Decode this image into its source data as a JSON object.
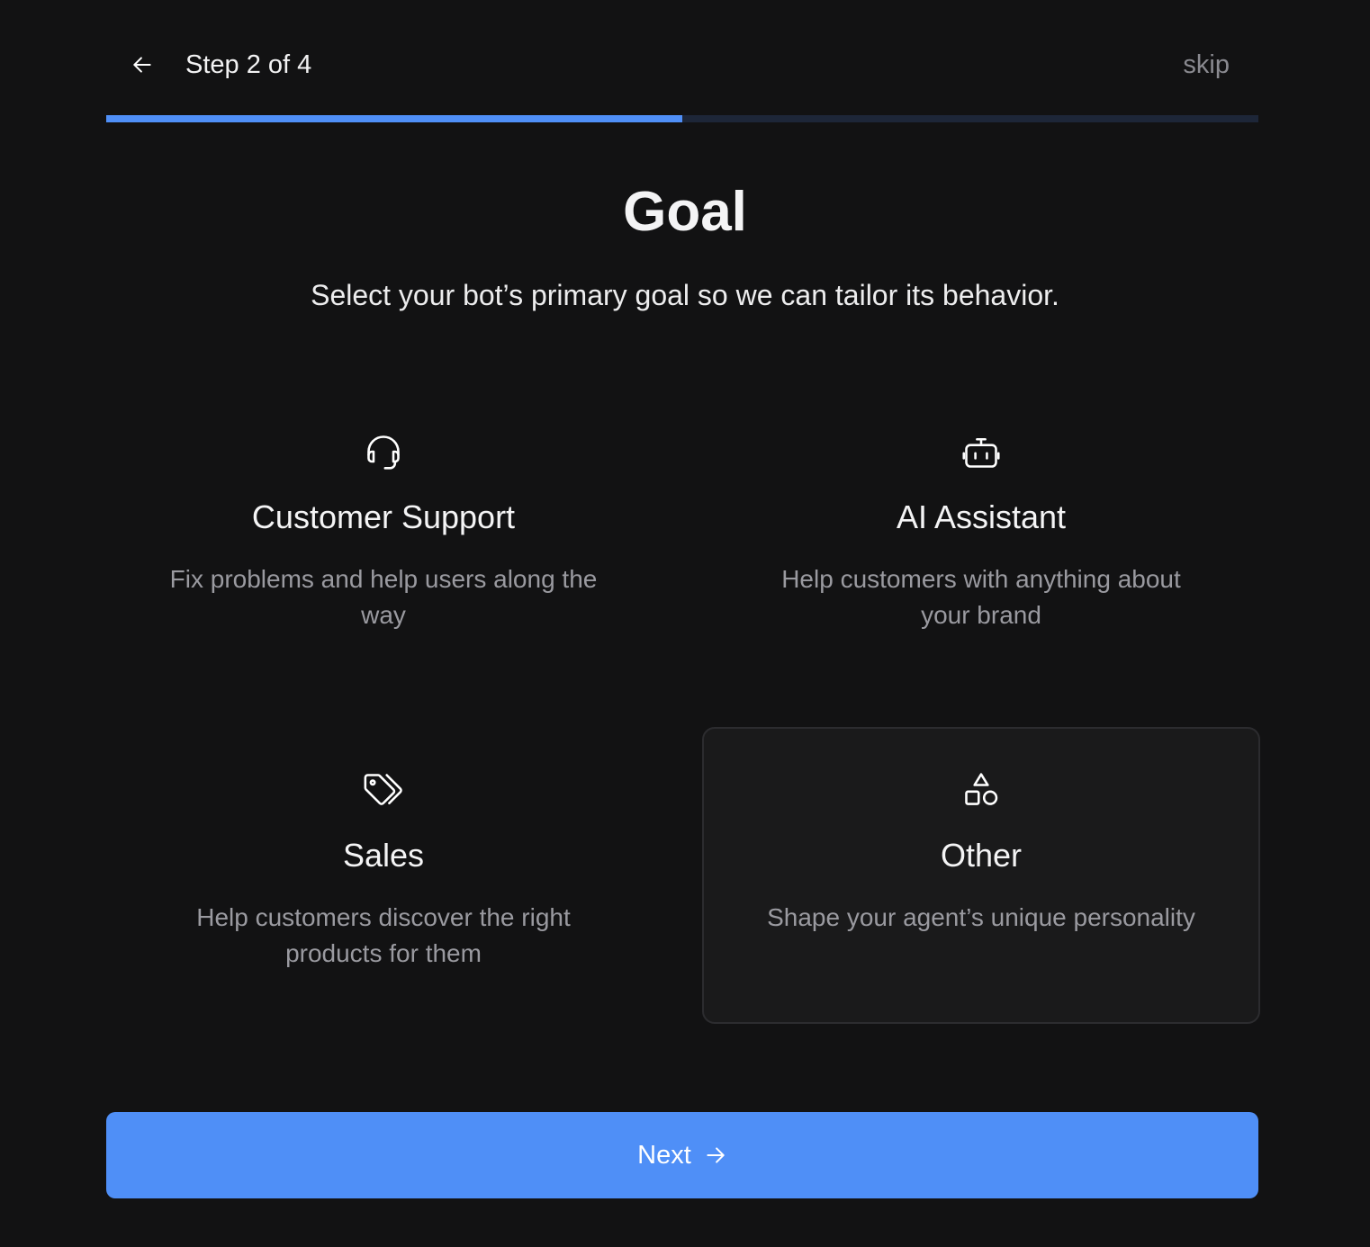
{
  "header": {
    "step_label": "Step 2 of 4",
    "skip_label": "skip",
    "back_icon": "arrow-left-icon"
  },
  "progress": {
    "current_step": 2,
    "total_steps": 4,
    "fraction": 0.5,
    "fill_color": "#4f8ff7",
    "track_color": "#1d2638"
  },
  "main": {
    "title": "Goal",
    "subtitle": "Select your bot’s primary goal so we can tailor its behavior."
  },
  "options": [
    {
      "id": "customer-support",
      "icon": "headset-icon",
      "title": "Customer Support",
      "description": "Fix problems and help users along the way",
      "selected": false
    },
    {
      "id": "ai-assistant",
      "icon": "robot-icon",
      "title": "AI Assistant",
      "description": "Help customers with anything about your brand",
      "selected": false
    },
    {
      "id": "sales",
      "icon": "tags-icon",
      "title": "Sales",
      "description": "Help customers discover the right products for them",
      "selected": false
    },
    {
      "id": "other",
      "icon": "shapes-icon",
      "title": "Other",
      "description": "Shape your agent’s unique personality",
      "selected": true
    }
  ],
  "footer": {
    "next_label": "Next",
    "next_icon": "arrow-right-icon",
    "button_color": "#4f8ff7"
  }
}
